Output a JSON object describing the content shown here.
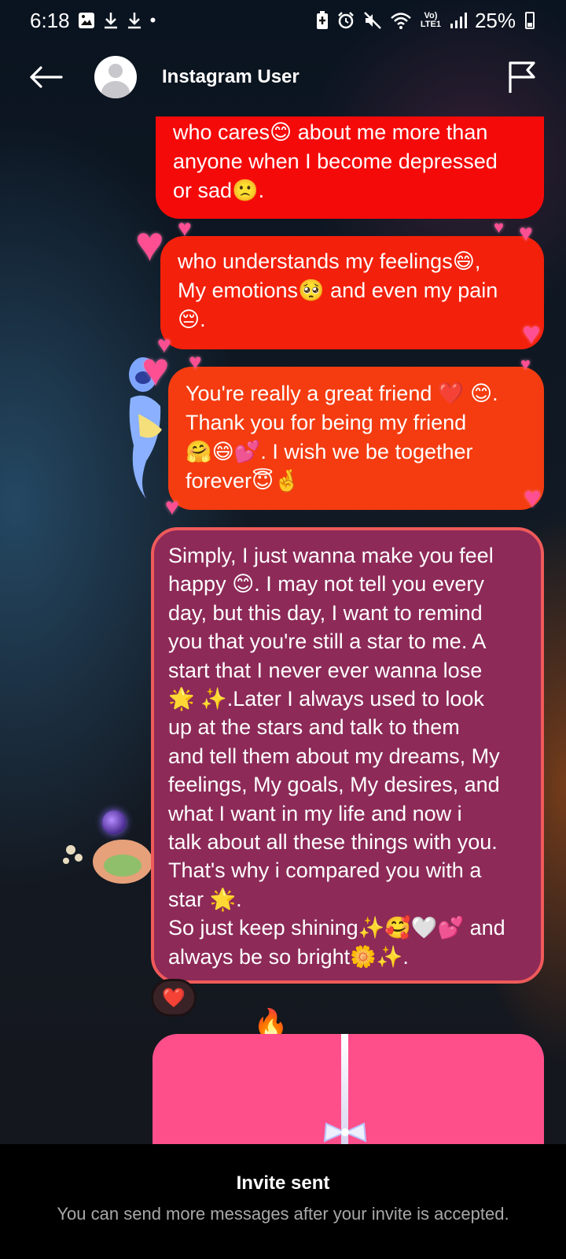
{
  "status_bar": {
    "time": "6:18",
    "left_icons": [
      "image-icon",
      "download-icon",
      "download-icon",
      "dot-icon"
    ],
    "right_icons": [
      "battery-saver-icon",
      "alarm-icon",
      "mute-icon",
      "wifi-icon",
      "volte-icon",
      "signal-icon"
    ],
    "network": "Vo) LTE1",
    "battery": "25%"
  },
  "header": {
    "title": "Instagram User",
    "back_icon": "back-arrow-icon",
    "report_icon": "flag-icon"
  },
  "messages": [
    {
      "text": "who cares😊 about me more than\nanyone when I become depressed\nor sad🙁."
    },
    {
      "text": "who understands my feelings😄,\nMy emotions🥺 and even my pain\n😔."
    },
    {
      "text": "You're really a great friend ❤️ 😊.\nThank you for being my friend\n🤗😄💕. I wish we be together\nforever😇🤞"
    },
    {
      "text": "Simply, I just wanna make you feel\nhappy 😊. I may not tell you every\nday, but this day, I want to remind\nyou that you're still a star to me. A\nstart that I never ever wanna lose\n🌟 ✨.Later I always used to look\nup at the stars and talk to them\nand tell them about my dreams, My\nfeelings, My goals, My desires, and\nwhat I want in my life and now i\ntalk about all these things with you.\nThat's why i compared you with a\nstar 🌟.\nSo just keep shining✨🥰🤍💕 and\nalways be so bright🌼✨."
    }
  ],
  "reaction": "❤️",
  "footer": {
    "title": "Invite sent",
    "subtitle": "You can send more messages after your invite is accepted."
  },
  "colors": {
    "bubble_1": "#f50a0a",
    "bubble_2": "#f3200b",
    "bubble_3": "#f43c10",
    "bubble_4": "#8d2a58",
    "bubble_4_border": "#ef5a5a",
    "card": "#ff4f8b",
    "heart": "#ff4f93",
    "footer_bg": "#000000"
  }
}
